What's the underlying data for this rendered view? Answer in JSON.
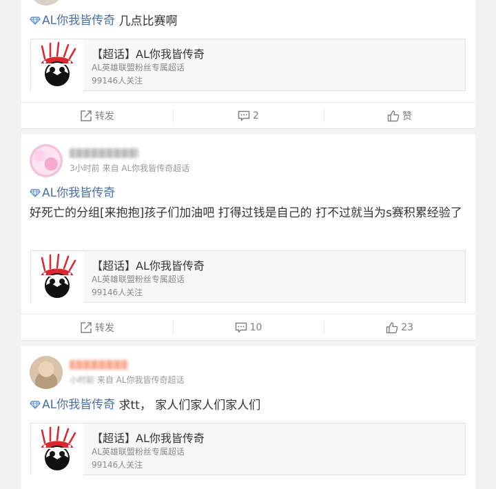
{
  "topic_label": "AL你我皆传奇",
  "posts": [
    {
      "text": "几点比赛啊",
      "actions": {
        "repost": "转发",
        "comment": "2",
        "like": "赞"
      }
    },
    {
      "meta_time": "3小时前",
      "meta_from": "来自 AL你我皆传奇超话",
      "text": "好死亡的分组[来抱抱]孩子们加油吧 打得过钱是自己的 打不过就当为s赛积累经验了",
      "actions": {
        "repost": "转发",
        "comment": "10",
        "like": "23"
      }
    },
    {
      "meta_time": "小时前",
      "meta_from": "来自 AL你我皆传奇超话",
      "text": "求tt， 家人们家人们家人们",
      "actions": {
        "repost": "转发",
        "comment": "",
        "like": ""
      }
    }
  ],
  "supertopic": {
    "title": "【超话】AL你我皆传奇",
    "desc": "AL英雄联盟粉丝专属超话",
    "fans": "99146人关注"
  },
  "colors": {
    "topic": "#4a6fa5",
    "action": "#808080",
    "logo_red": "#d9282f"
  }
}
